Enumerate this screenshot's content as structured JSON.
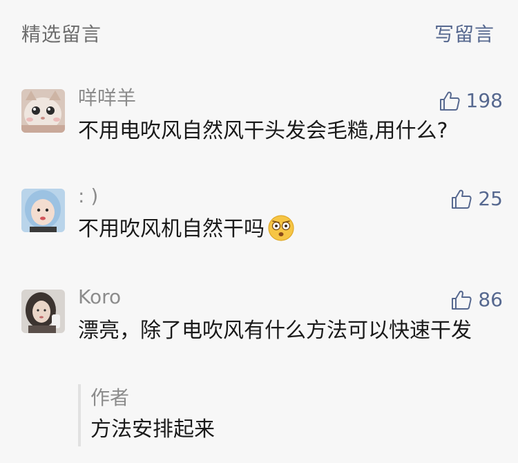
{
  "header": {
    "title": "精选留言",
    "write_label": "写留言"
  },
  "comments": [
    {
      "nickname": "咩咩羊",
      "likes": "198",
      "content": "不用电吹风自然风干头发会毛糙,用什么?"
    },
    {
      "nickname": ": )",
      "likes": "25",
      "content": "不用吹风机自然干吗",
      "emoji": "shocked-face-emoji"
    },
    {
      "nickname": "Koro",
      "likes": "86",
      "content": "漂亮，除了电吹风有什么方法可以快速干发",
      "reply": {
        "author": "作者",
        "text": "方法安排起来"
      }
    }
  ],
  "colors": {
    "link": "#56688f",
    "muted": "#8c8c8c",
    "background": "#f7f7f7"
  }
}
